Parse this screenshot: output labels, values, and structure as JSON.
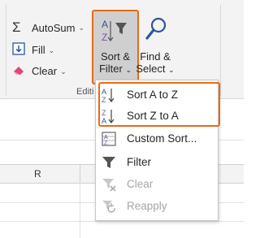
{
  "ribbon": {
    "autosum_label": "AutoSum",
    "fill_label": "Fill",
    "clear_label": "Clear",
    "sort_filter_line1": "Sort &",
    "sort_filter_line2": "Filter",
    "find_select_line1": "Find &",
    "find_select_line2": "Select",
    "group_label": "Editi"
  },
  "grid": {
    "column_header": "R"
  },
  "menu": {
    "sort_a_z": "Sort A to Z",
    "sort_z_a": "Sort Z to A",
    "custom_sort": "Custom Sort...",
    "filter": "Filter",
    "clear": "Clear",
    "reapply": "Reapply"
  },
  "colors": {
    "highlight": "#e36c18",
    "accent_blue": "#2b579a",
    "icon_purple": "#7b54a8"
  }
}
